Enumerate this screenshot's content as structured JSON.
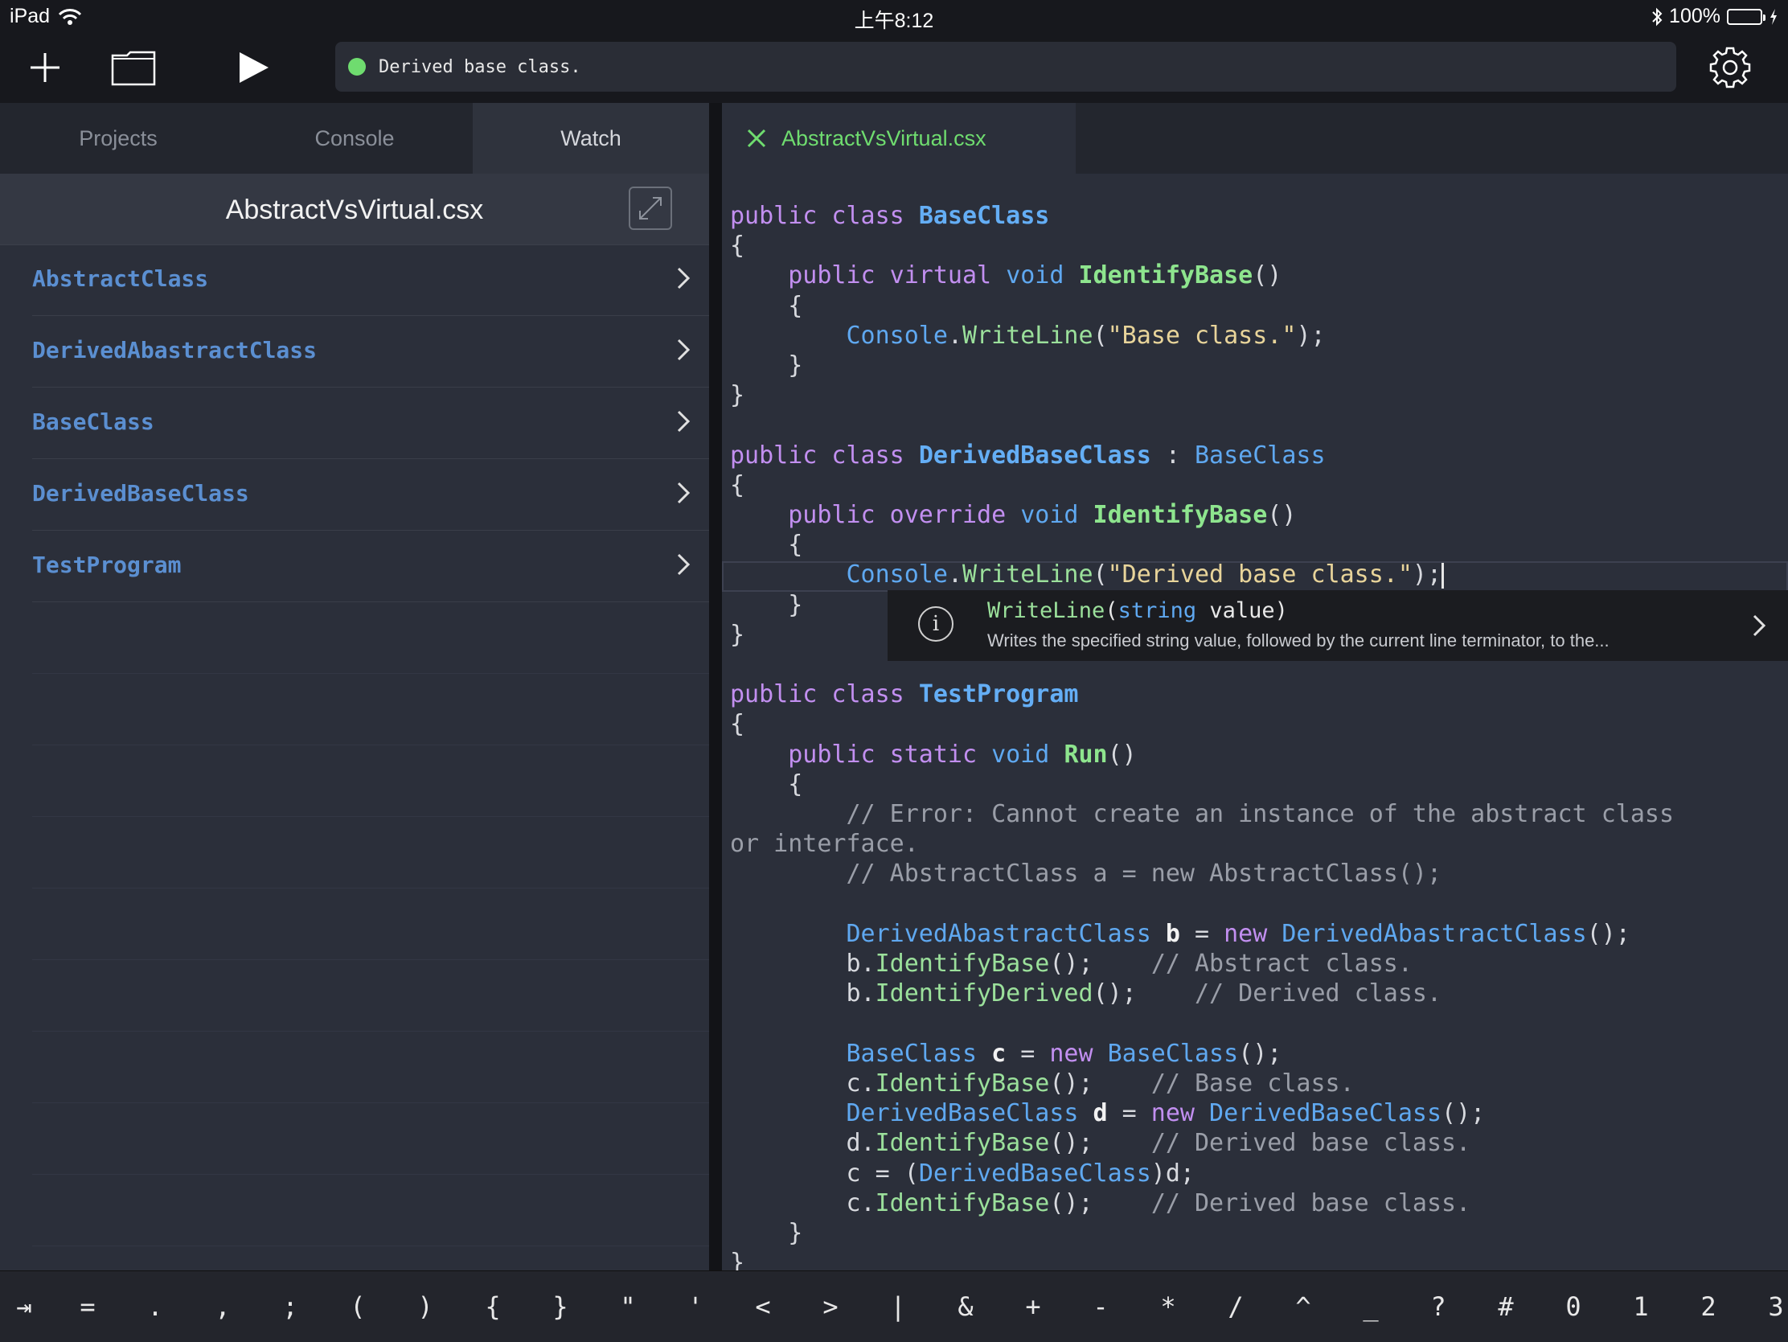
{
  "status_bar": {
    "device": "iPad",
    "time": "上午8:12",
    "battery": "100%",
    "battery_level": 1.0
  },
  "toolbar": {
    "run_status": "Derived base class."
  },
  "left_panel": {
    "tabs": [
      {
        "label": "Projects"
      },
      {
        "label": "Console"
      },
      {
        "label": "Watch"
      }
    ],
    "active_tab": "Watch",
    "title": "AbstractVsVirtual.csx",
    "items": [
      {
        "label": "AbstractClass"
      },
      {
        "label": "DerivedAbastractClass"
      },
      {
        "label": "BaseClass"
      },
      {
        "label": "DerivedBaseClass"
      },
      {
        "label": "TestProgram"
      }
    ]
  },
  "editor": {
    "file_tab": "AbstractVsVirtual.csx",
    "code": {
      "l1_kw": "public class ",
      "l1_cls": "BaseClass",
      "ob": "{",
      "cb": "}",
      "l3_kw1": "public virtual ",
      "l3_ty": "void ",
      "l3_fn": "IdentifyBase",
      "l3_rest": "()",
      "console": "Console",
      "writeline": "WriteLine",
      "dot": ".",
      "str_base": "\"Base class.\"",
      "str_derived": "\"Derived base class.\"",
      "paren_open": "(",
      "paren_close_semi": ");",
      "l9_kw": "public class ",
      "l9_cls": "DerivedBaseClass",
      "l9_colon": " : ",
      "l9_ty": "BaseClass",
      "l11_kw1": "public override ",
      "l11_ty": "void ",
      "l11_fn": "IdentifyBase",
      "l11_rest": "()",
      "l17_kw": "public class ",
      "l17_cls": "TestProgram",
      "l19_kw": "public static ",
      "l19_ty": "void ",
      "l19_fn": "Run",
      "l19_rest": "()",
      "cm1a": "// Error: Cannot create an instance of the abstract class",
      "cm1b": "or interface.",
      "cm2": "// AbstractClass a = new AbstractClass();",
      "dac": "DerivedAbastractClass",
      "var_b": "b",
      "eq": " = ",
      "new": "new ",
      "call_end": "();",
      "b_prefix": "b.",
      "c_prefix": "c.",
      "d_prefix": "d.",
      "identifybase": "IdentifyBase",
      "identifyderived": "IdentifyDerived",
      "cm_abs": "// Abstract class.",
      "cm_der": "// Derived class.",
      "cm_base": "// Base class.",
      "cm_derbase": "// Derived base class.",
      "baseclass": "BaseClass",
      "var_c": "c",
      "derivedbaseclass": "DerivedBaseClass",
      "var_d": "d",
      "cast_pre": "c = (",
      "cast_post": ")d;"
    },
    "tooltip": {
      "method": "WriteLine",
      "type": "string",
      "signature_rest": " value)",
      "description": "Writes the specified string value, followed by the current line terminator, to the..."
    }
  },
  "keyboard_bar": {
    "keys": [
      "⇥",
      "=",
      ".",
      ",",
      ";",
      "(",
      ")",
      "{",
      "}",
      "\"",
      "'",
      "<",
      ">",
      "|",
      "&",
      "+",
      "-",
      "*",
      "/",
      "^",
      "_",
      "?",
      "#",
      "0",
      "1",
      "2",
      "3"
    ]
  },
  "colors": {
    "accent_green": "#6fdc6f",
    "keyword": "#c28ff0",
    "type": "#5fa8f0",
    "string": "#e8d49a",
    "comment": "#9a9ea8"
  }
}
